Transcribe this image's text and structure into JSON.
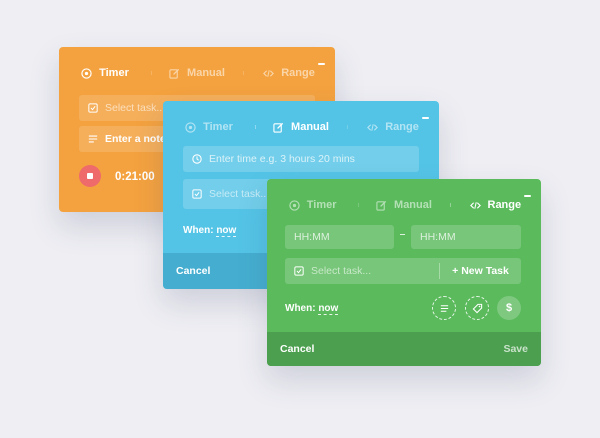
{
  "cards": {
    "timer": {
      "tabs": [
        "Timer",
        "Manual",
        "Range"
      ],
      "task_placeholder": "Select task...",
      "note_placeholder": "Enter a note",
      "elapsed": "0:21:00"
    },
    "manual": {
      "tabs": [
        "Timer",
        "Manual",
        "Range"
      ],
      "time_placeholder": "Enter time e.g. 3 hours 20 mins",
      "task_placeholder": "Select task...",
      "when_label": "When:",
      "when_value": "now",
      "cancel_label": "Cancel"
    },
    "range": {
      "tabs": [
        "Timer",
        "Manual",
        "Range"
      ],
      "start_placeholder": "HH:MM",
      "end_placeholder": "HH:MM",
      "task_placeholder": "Select task...",
      "new_task_label": "+ New Task",
      "when_label": "When:",
      "when_value": "now",
      "cancel_label": "Cancel",
      "save_label": "Save",
      "currency_symbol": "$"
    }
  },
  "colors": {
    "timer": "#f4a23f",
    "manual": "#54c4e6",
    "range": "#5aba5c",
    "record": "#ee6a6b"
  }
}
